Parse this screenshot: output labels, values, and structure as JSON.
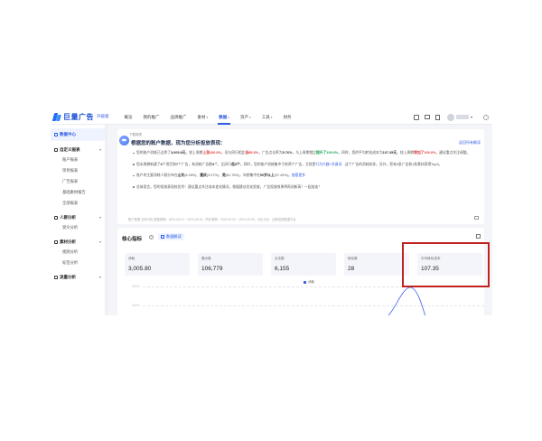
{
  "topbar": {
    "brand": "巨量广告",
    "plan": "升级版",
    "nav": [
      {
        "label": "概览",
        "active": false,
        "caret": false
      },
      {
        "label": "我的推广",
        "active": false,
        "caret": false
      },
      {
        "label": "品牌推广",
        "active": false,
        "caret": false
      },
      {
        "label": "素材",
        "active": false,
        "caret": true
      },
      {
        "label": "数据",
        "active": true,
        "caret": true
      },
      {
        "label": "资产",
        "active": false,
        "caret": true
      },
      {
        "label": "工具",
        "active": false,
        "caret": true
      },
      {
        "label": "财务",
        "active": false,
        "caret": false
      }
    ]
  },
  "sidebar": {
    "head": "数据中心",
    "sections": [
      {
        "title": "自定义报表",
        "items": [
          "账户报表",
          "项目报表",
          "广告报表",
          "基础素材报告",
          "全部报表"
        ]
      },
      {
        "title": "人群分析",
        "items": [
          "受众分析"
        ]
      },
      {
        "title": "素材分析",
        "items": [
          "视频分析",
          "标签分析"
        ]
      },
      {
        "title": "流量分析",
        "items": []
      }
    ]
  },
  "insight": {
    "tag": "下载报表",
    "greeting": "根据您的账户数据，现为您分析投放表现：",
    "reports_link": "返回所有解读",
    "bullets": [
      [
        "您的账户消耗已达到了",
        "b:3,005.8元",
        "，较上周期",
        "red:上涨100.0%",
        "，但与同行相比",
        "red:低85.3%",
        "。广告点击率为",
        "b:5.76%",
        "，与上周期相比",
        "green:提升了100.0%",
        "，同时，您的平均转化成本为",
        "b:107.35元",
        "，较上周期",
        "red:增加了100.0%",
        "，建议重点关注调整。"
      ],
      [
        "您本周期新建了",
        "b:6",
        "个项目和",
        "b:7",
        "个广告，有消耗广告数",
        "b:3",
        "个，比同行",
        "b:低5个",
        "。同时，您的账户消耗集中于前两个广告，尤其是",
        "lnk:行为兴趣+关键词…",
        "这个广告的消耗较多。另外，您有3条广告和1条素材获得Top3。"
      ],
      [
        "账户的主要消耗人群分布在",
        "b:山东",
        "(8.26%)、",
        "b:重庆",
        "(3.07%)、",
        "b:男",
        "(81.78%)，年龄集中在",
        "b:50岁以上",
        "(37.45%)。",
        "lnk:查看更多"
      ],
      [
        "总体而言，您的投放表现较优秀！建议重点关注成本变化情况，根据建议优化投放，广告投放效果将再创新高！一起加油！"
      ]
    ],
    "footer": "账户数据   总体分析   数据周期：2023-09-10 ~ 2023-09-16，同比周期：2023-09-03 ~ 2023-09-09，对比行业：创新投放数据平台"
  },
  "metrics": {
    "title": "核心指标",
    "help": "?",
    "interpret": "数据解读",
    "cards": [
      {
        "label": "消耗",
        "value": "3,005.80"
      },
      {
        "label": "展示数",
        "value": "106,779"
      },
      {
        "label": "点击数",
        "value": "6,155"
      },
      {
        "label": "转化数",
        "value": "28"
      },
      {
        "label": "平均转化成本",
        "value": "107.35"
      }
    ],
    "chart_legend": "消耗",
    "chart_yticks": [
      "200%",
      "100%"
    ]
  },
  "colors": {
    "accent": "#2d5be3",
    "highlight_border": "#c0231f",
    "up_red": "#e23a3a",
    "up_green": "#13a454"
  }
}
